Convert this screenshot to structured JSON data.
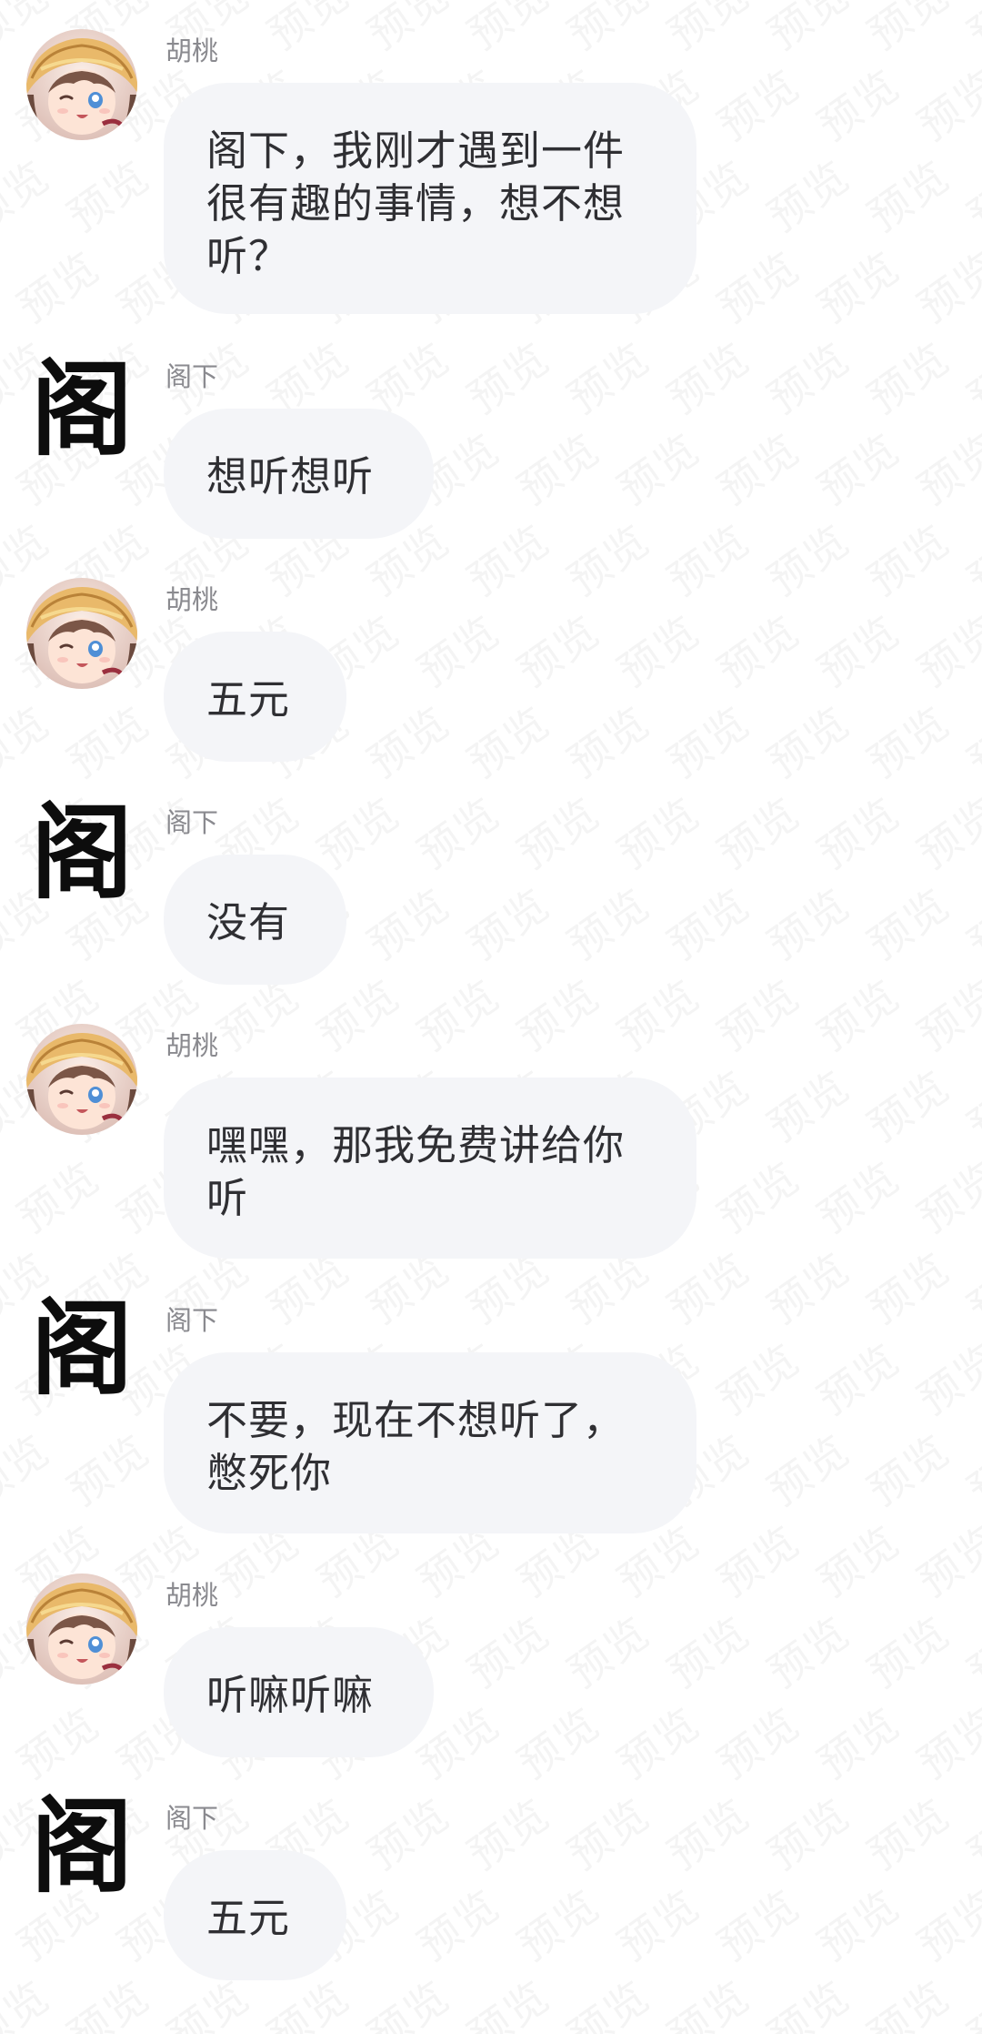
{
  "watermark": {
    "text": "预览"
  },
  "messages": [
    {
      "sender": "胡桃",
      "avatar": "hutao-avatar",
      "text": "阁下，我刚才遇到一件\n很有趣的事情，想不想\n听？"
    },
    {
      "sender": "阁下",
      "avatar": "gexia-avatar",
      "avatar_text": "阁",
      "text": "想听想听"
    },
    {
      "sender": "胡桃",
      "avatar": "hutao-avatar",
      "text": "五元"
    },
    {
      "sender": "阁下",
      "avatar": "gexia-avatar",
      "avatar_text": "阁",
      "text": "没有"
    },
    {
      "sender": "胡桃",
      "avatar": "hutao-avatar",
      "text": "嘿嘿，那我免费讲给你\n听"
    },
    {
      "sender": "阁下",
      "avatar": "gexia-avatar",
      "avatar_text": "阁",
      "text": "不要，现在不想听了，\n憋死你"
    },
    {
      "sender": "胡桃",
      "avatar": "hutao-avatar",
      "text": "听嘛听嘛"
    },
    {
      "sender": "阁下",
      "avatar": "gexia-avatar",
      "avatar_text": "阁",
      "text": "五元"
    }
  ]
}
